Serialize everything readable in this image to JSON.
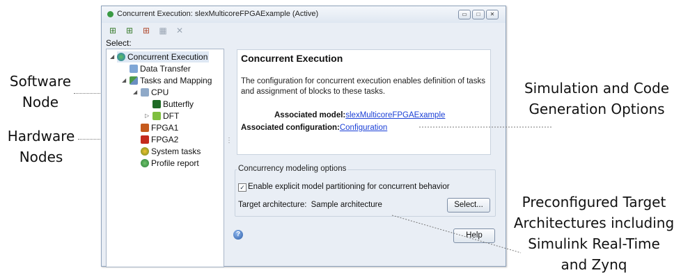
{
  "window": {
    "title": "Concurrent Execution: slexMulticoreFPGAExample (Active)",
    "controls": {
      "minimize": "▭",
      "maximize": "□",
      "close": "✕"
    }
  },
  "toolbar": {
    "icons": [
      "add-task-icon",
      "add-group-icon",
      "add-node-icon",
      "grid-icon",
      "delete-icon"
    ]
  },
  "select_label": "Select:",
  "tree": {
    "items": [
      {
        "label": "Concurrent Execution",
        "icon": "globe-icon"
      },
      {
        "label": "Data Transfer",
        "icon": "data-transfer-icon"
      },
      {
        "label": "Tasks and Mapping",
        "icon": "tasks-icon"
      },
      {
        "label": "CPU",
        "icon": "cpu-icon"
      },
      {
        "label": "Butterfly",
        "icon": "task-icon"
      },
      {
        "label": "DFT",
        "icon": "task-group-icon"
      },
      {
        "label": "FPGA1",
        "icon": "fpga-icon"
      },
      {
        "label": "FPGA2",
        "icon": "fpga-icon"
      },
      {
        "label": "System tasks",
        "icon": "system-tasks-icon"
      },
      {
        "label": "Profile report",
        "icon": "profile-icon"
      }
    ]
  },
  "panel": {
    "title": "Concurrent Execution",
    "description": "The configuration for concurrent execution enables definition of tasks and assignment of blocks to these tasks.",
    "model_label": "Associated model:",
    "model_value": "slexMulticoreFPGAExample",
    "config_label": "Associated configuration:",
    "config_value": "Configuration"
  },
  "options": {
    "group_label": "Concurrency modeling options",
    "checkbox_label": "Enable explicit model partitioning for concurrent behavior",
    "checkbox_checked": true,
    "target_label": "Target architecture:",
    "target_value": "Sample architecture",
    "select_button": "Select..."
  },
  "help_button": "Help",
  "annotations": {
    "software_node": [
      "Software",
      "Node"
    ],
    "hardware_nodes": [
      "Hardware",
      "Nodes"
    ],
    "sim_codegen": [
      "Simulation and Code",
      "Generation Options"
    ],
    "preconfigured": [
      "Preconfigured Target",
      "Architectures including",
      "Simulink Real-Time",
      "and Zynq"
    ]
  },
  "colors": {
    "link": "#1a3fd6",
    "window_bg": "#e9eef5"
  }
}
